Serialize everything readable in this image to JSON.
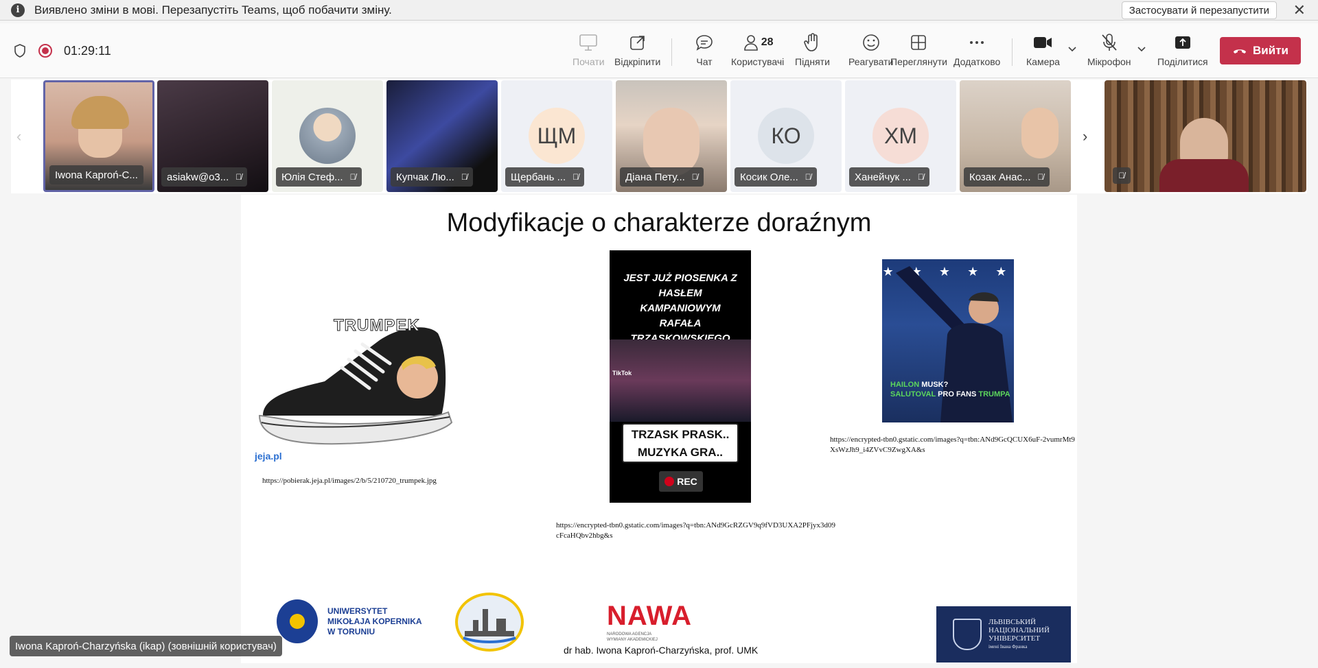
{
  "notification": {
    "message": "Виявлено зміни в мові. Перезапустіть Teams, щоб побачити зміну.",
    "apply_label": "Застосувати й перезапустити",
    "close_glyph": "✕"
  },
  "toolbar": {
    "timer": "01:29:11",
    "present_label": "Почати",
    "popout_label": "Відкріпити",
    "chat_label": "Чат",
    "people_label": "Користувачі",
    "people_count": "28",
    "raise_label": "Підняти",
    "react_label": "Реагувати",
    "view_label": "Переглянути",
    "more_label": "Додатково",
    "camera_label": "Камера",
    "mic_label": "Мікрофон",
    "share_label": "Поділитися",
    "leave_label": "Вийти",
    "accent_color": "#c4314b"
  },
  "participants": [
    {
      "name": "Iwona Kaproń-C..."
    },
    {
      "name": "asiakw@o3..."
    },
    {
      "name": "Юлія Стеф..."
    },
    {
      "name": "Купчак Лю..."
    },
    {
      "name": "Щербань ...",
      "initials": "ЩМ"
    },
    {
      "name": "Діана Пету..."
    },
    {
      "name": "Косик Оле...",
      "initials": "КО"
    },
    {
      "name": "Ханейчук ...",
      "initials": "ХМ"
    },
    {
      "name": "Козак Анас..."
    }
  ],
  "slide": {
    "title": "Modyfikacje o charakterze doraźnym",
    "shoe_caption": "TRUMPEK",
    "shoe_watermark": "jeja.pl",
    "shoe_url": "https://pobierak.jeja.pl/images/2/b/5/210720_trumpek.jpg",
    "tiktok_top": "JEST JUŻ PIOSENKA Z HASŁEM KAMPANIOWYM RAFAŁA TRZASKOWSKIEGO",
    "tiktok_box_line1": "TRZASK PRASK..",
    "tiktok_box_line2": "MUZYKA GRA..",
    "tiktok_rec": "REC",
    "tiktok_brand": "TikTok",
    "tiktok_url": "https://encrypted-tbn0.gstatic.com/images?q=tbn:ANd9GcRZGV9q9fVD3UXA2PFjyx3d09cFcaHQbv2hbg&s",
    "musk_line1_green": "HAILON",
    "musk_line1_white": " MUSK?",
    "musk_line2_green": "SALUTOVAL",
    "musk_line2_white": " PRO FANS ",
    "musk_line2_end": "TRUMPA",
    "musk_url": "https://encrypted-tbn0.gstatic.com/images?q=tbn:ANd9GcQCUX6uF-2vumrMt9XsWzJh9_i4ZVvC9ZwgXA&s",
    "umk_line1": "UNIWERSYTET",
    "umk_line2": "MIKOŁAJA KOPERNIKA",
    "umk_line3": "W TORUNIU",
    "nawa_big": "NAWA",
    "nawa_small1": "NARODOWA AGENCJA",
    "nawa_small2": "WYMIANY AKADEMICKIEJ",
    "lnu_line1": "ЛЬВІВСЬКИЙ",
    "lnu_line2": "НАЦІОНАЛЬНИЙ",
    "lnu_line3": "УНІВЕРСИТЕТ",
    "lnu_line4": "імені Івана Франка",
    "author": "dr hab. Iwona Kaproń-Charzyńska, prof. UMK"
  },
  "speaker": {
    "label": "Iwona Kaproń-Charzyńska (ikap) (зовнішній користувач)"
  }
}
